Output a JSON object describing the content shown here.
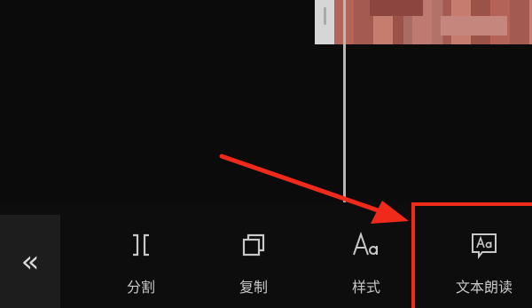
{
  "toolbar": {
    "collapse_glyph": "«",
    "tools": [
      {
        "id": "split",
        "label": "分割",
        "icon": "split-icon"
      },
      {
        "id": "copy",
        "label": "复制",
        "icon": "copy-icon"
      },
      {
        "id": "style",
        "label": "样式",
        "icon": "text-style-icon"
      },
      {
        "id": "tts",
        "label": "文本朗读",
        "icon": "text-to-speech-icon"
      }
    ]
  },
  "annotation": {
    "color": "#ef2a1b"
  }
}
